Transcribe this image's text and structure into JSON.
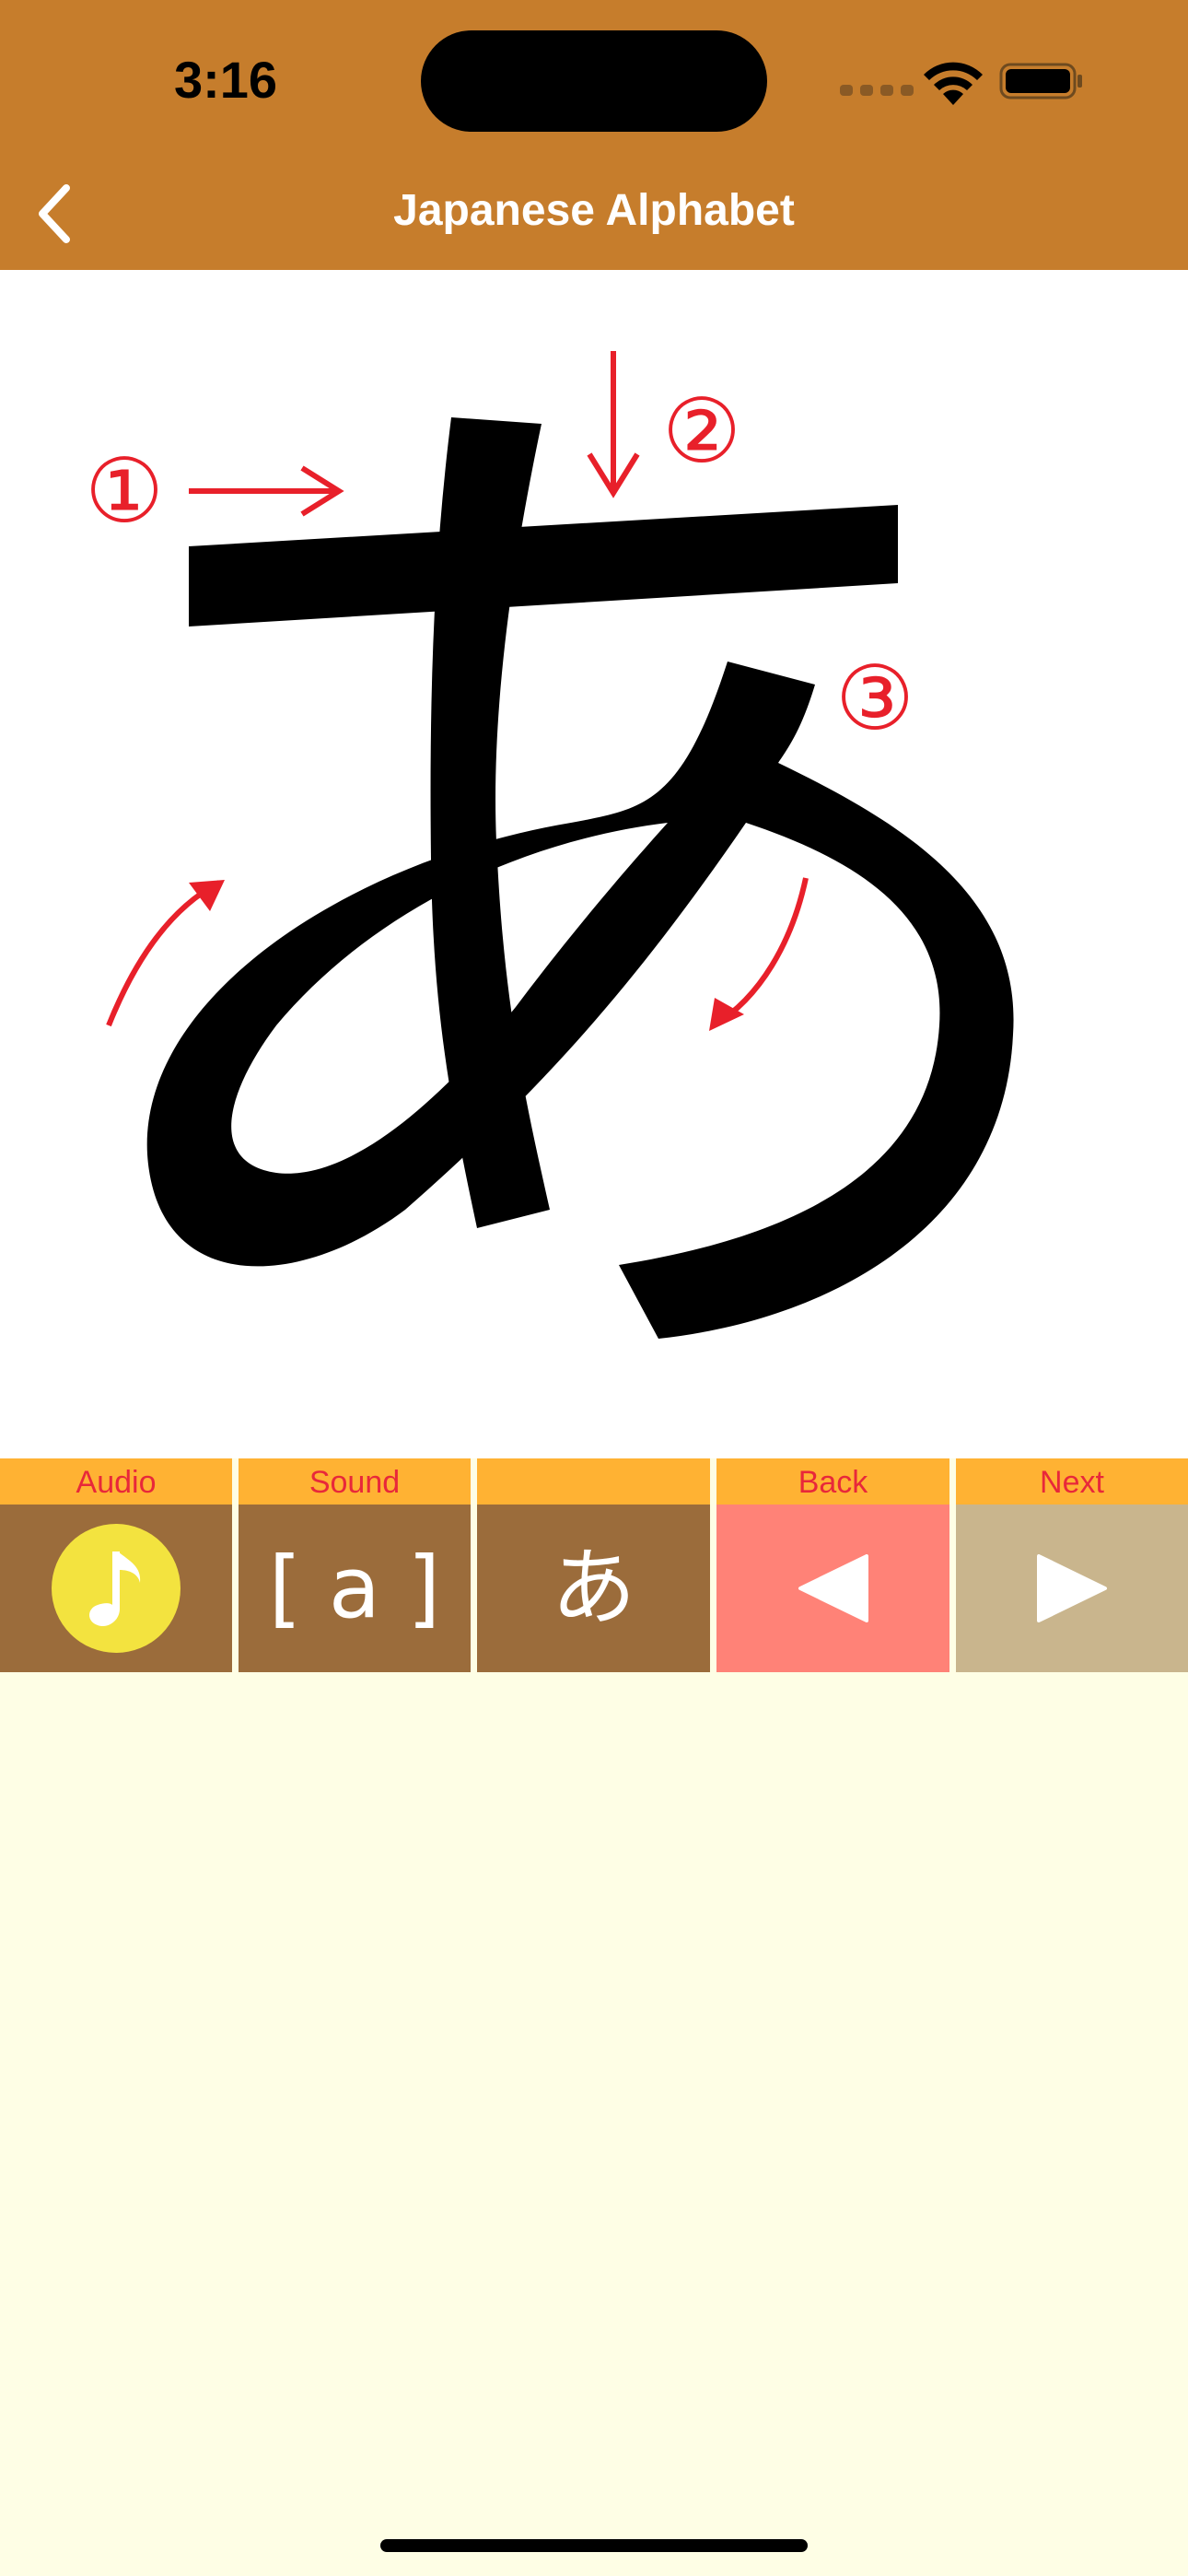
{
  "status": {
    "time": "3:16"
  },
  "nav": {
    "title": "Japanese Alphabet"
  },
  "stroke_order": {
    "character": "あ",
    "stroke_numbers": [
      "①",
      "②",
      "③"
    ]
  },
  "toolbar": {
    "items": [
      {
        "label": "Audio",
        "content": ""
      },
      {
        "label": "Sound",
        "content": "[ a ]"
      },
      {
        "label": "",
        "content": "あ"
      },
      {
        "label": "Back",
        "content": ""
      },
      {
        "label": "Next",
        "content": ""
      }
    ]
  },
  "colors": {
    "header": "#C67D2C",
    "tool_label_bg": "#FFB233",
    "tool_label_text": "#E8283A",
    "tool_bg": "#9B6C3B",
    "back_bg": "#FF8277",
    "next_bg": "#C9B58D",
    "audio_circle": "#F3E33F",
    "page_bg": "#FEFEE5",
    "stroke_annotation": "#E8202A"
  },
  "icons": {
    "audio": "music-note-icon",
    "back": "triangle-left-icon",
    "next": "triangle-right-icon",
    "nav_back": "chevron-left-icon"
  }
}
